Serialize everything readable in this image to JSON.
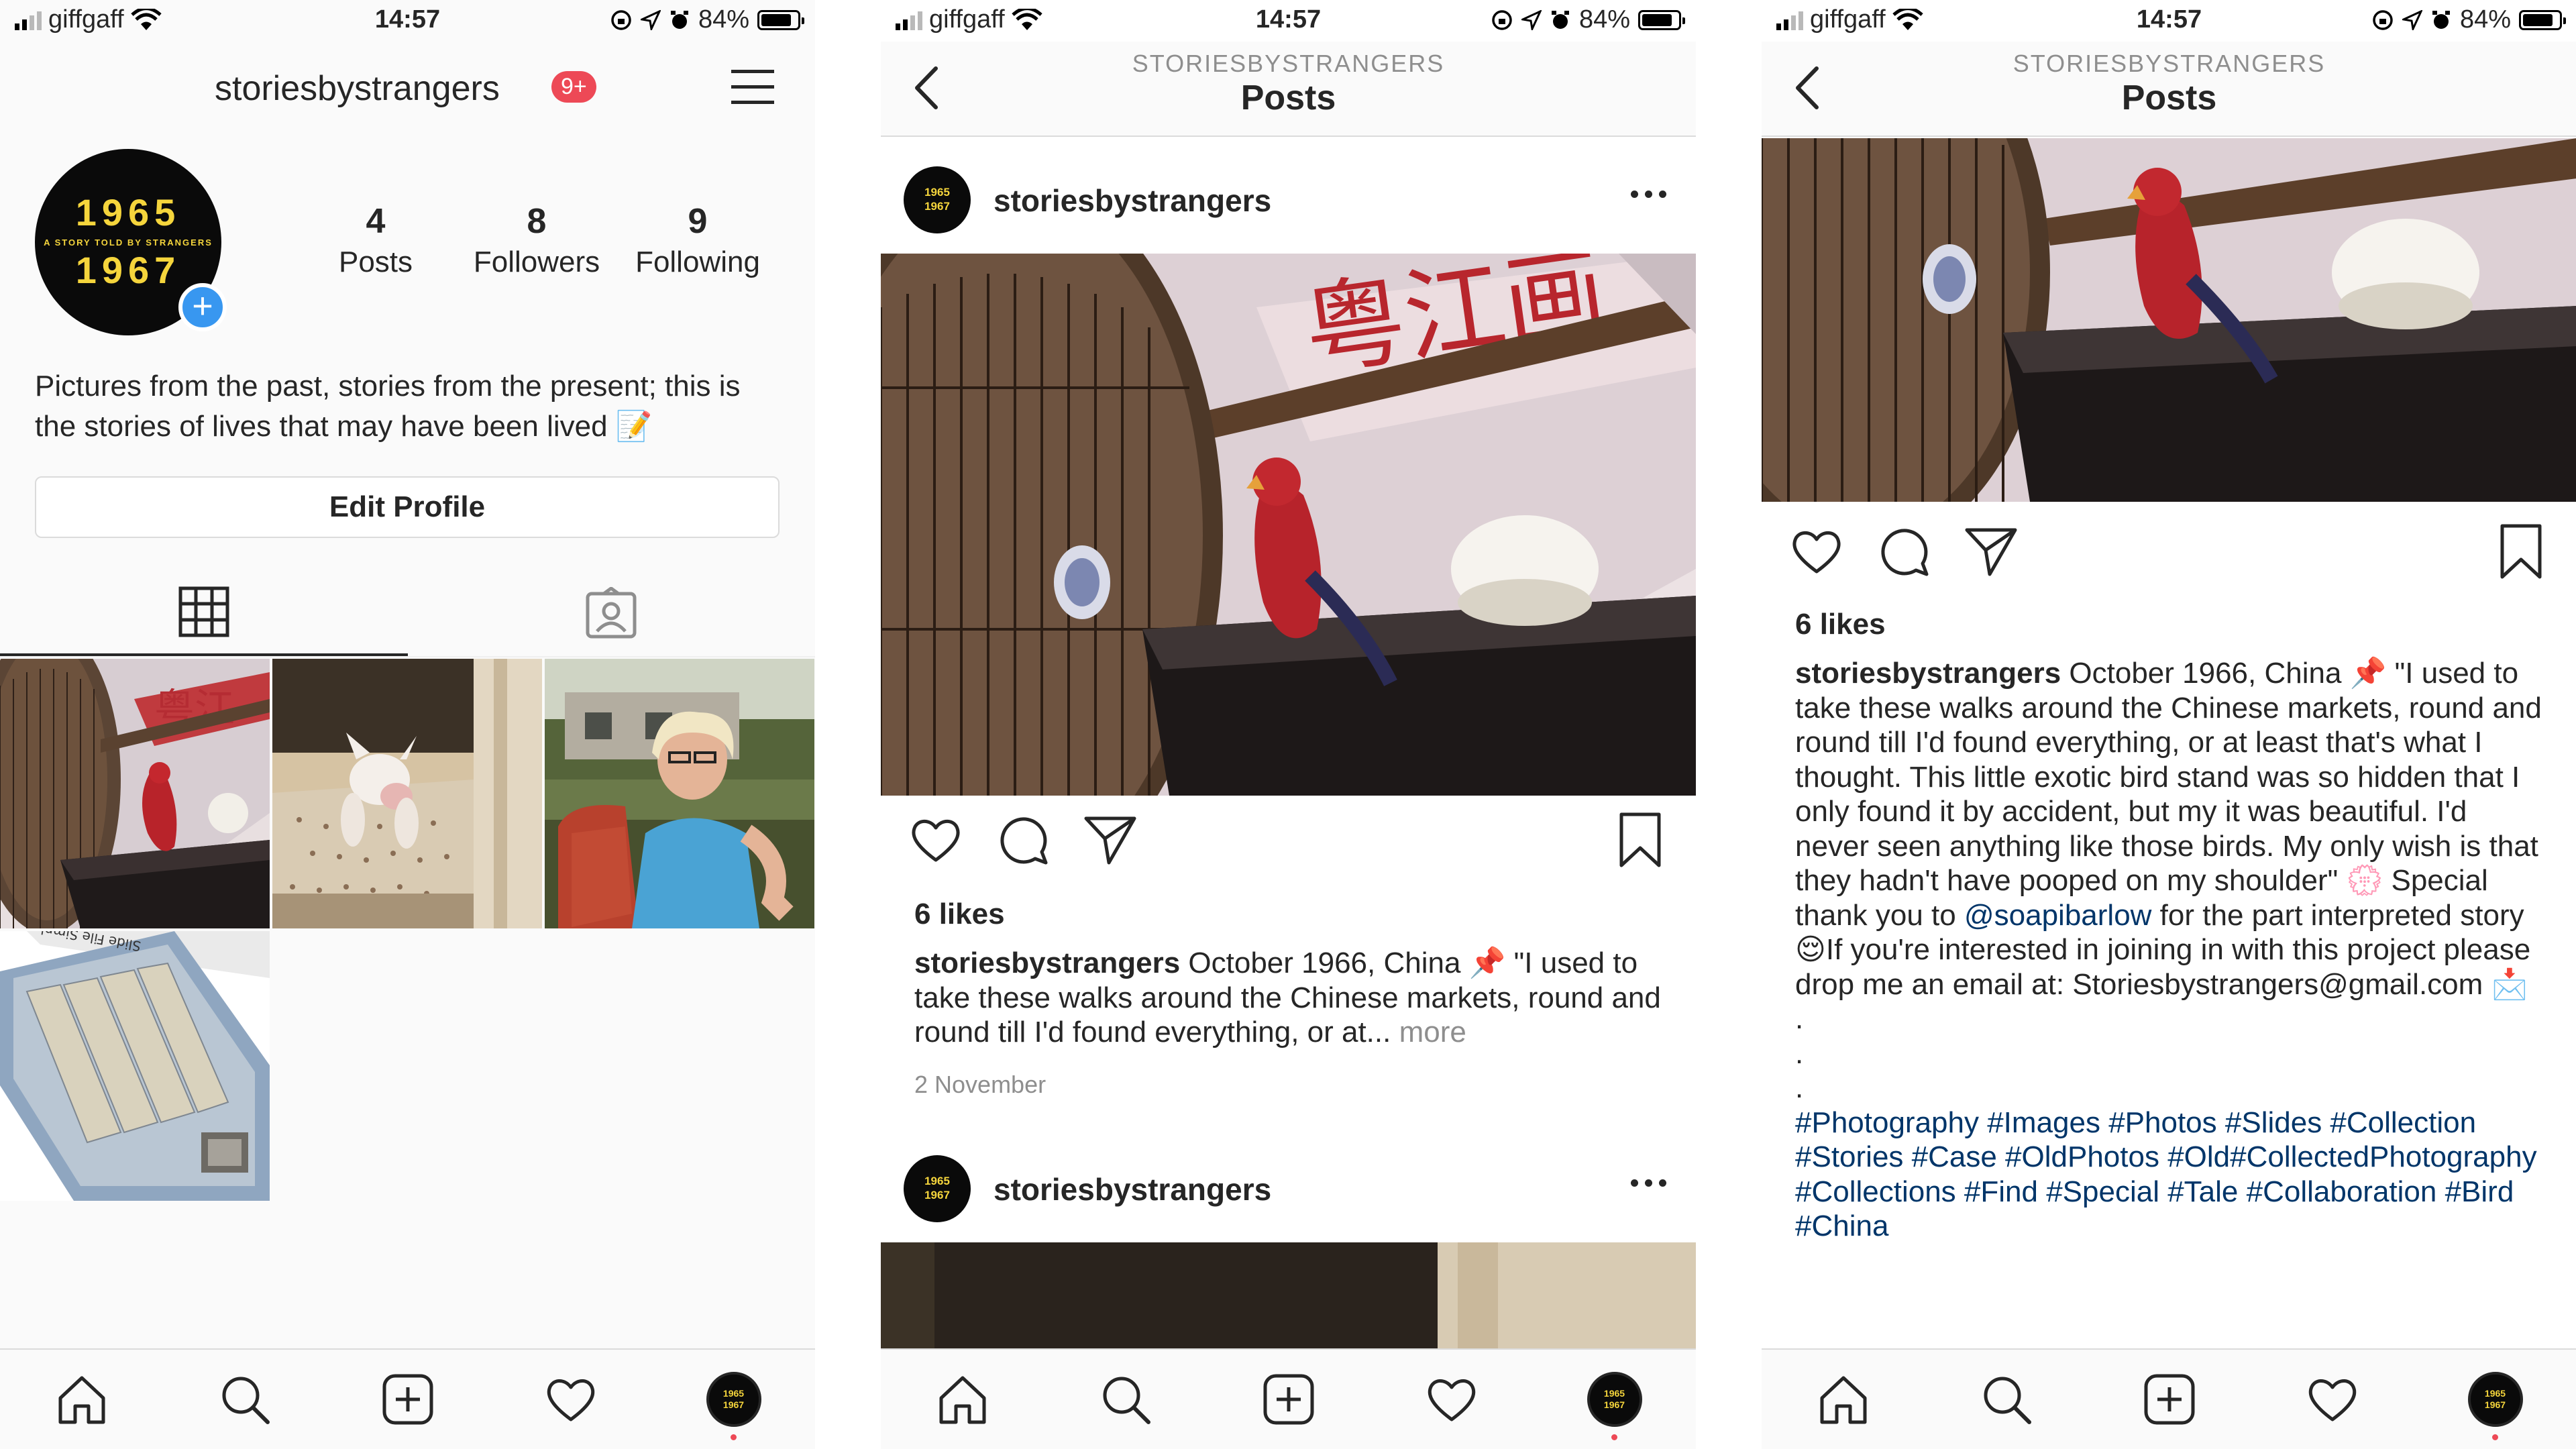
{
  "status": {
    "carrier": "giffgaff",
    "time": "14:57",
    "battery": "84%"
  },
  "profile": {
    "username": "storiesbystrangers",
    "notification_badge": "9+",
    "avatar_year_top": "1965",
    "avatar_tagline": "A STORY TOLD BY STRANGERS",
    "avatar_year_bottom": "1967",
    "avatar_plus": "+",
    "stats": [
      {
        "num": "4",
        "label": "Posts"
      },
      {
        "num": "8",
        "label": "Followers"
      },
      {
        "num": "9",
        "label": "Following"
      }
    ],
    "bio": "Pictures from the past, stories from the present; this is the stories of lives that may have been lived 📝",
    "edit_profile": "Edit Profile"
  },
  "nav_avatar": {
    "top": "1965",
    "bottom": "1967"
  },
  "post_screen": {
    "subtitle": "STORIESBYSTRANGERS",
    "title": "Posts"
  },
  "post": {
    "username": "storiesbystrangers",
    "likes": "6 likes",
    "caption_short": "October 1966, China 📌 \"I used to take these walks around the Chinese markets, round and round till I'd found everything, or at...",
    "more": "more",
    "date": "2 November",
    "caption_full_1": "October 1966, China 📌 \"I used to take these walks around the Chinese markets, round and round till I'd found everything, or at least that's what I thought. This little exotic bird stand was so hidden that I only found it by accident, but my it was beautiful. I'd never seen anything like those birds. My only wish is that they hadn't have pooped on my shoulder\" 💮 Special thank you to",
    "mention": "@soapibarlow",
    "caption_full_2": "for the part interpreted story 😌If you're interested in joining in with this project please drop me an email at: Storiesbystrangers@gmail.com 📩",
    "dot1": ".",
    "dot2": ".",
    "dot3": ".",
    "hashtags": "#Photography #Images #Photos #Slides #Collection #Stories #Case #OldPhotos #Old#CollectedPhotography #Collections #Find #Special #Tale #Collaboration #Bird #China"
  },
  "post2": {
    "username": "storiesbystrangers"
  }
}
